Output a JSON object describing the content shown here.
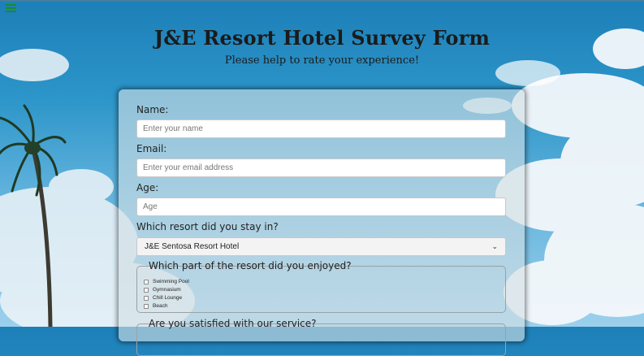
{
  "header": {
    "title": "J&E Resort Hotel Survey Form",
    "subtitle": "Please help to rate your experience!"
  },
  "icons": {
    "menu": "hamburger-menu-icon"
  },
  "colors": {
    "menu_icon": "#1c8a2a"
  },
  "form": {
    "name": {
      "label": "Name:",
      "placeholder": "Enter your name"
    },
    "email": {
      "label": "Email:",
      "placeholder": "Enter your email address"
    },
    "age": {
      "label": "Age:",
      "placeholder": "Age"
    },
    "resort": {
      "label": "Which resort did you stay in?",
      "selected": "J&E Sentosa Resort Hotel"
    },
    "facilities": {
      "legend": "Which part of the resort did you enjoyed?",
      "options": [
        "Swimming Pool",
        "Gymnasium",
        "Chill Lounge",
        "Beach"
      ]
    },
    "satisfaction": {
      "legend": "Are you satisfied with our service?"
    }
  }
}
